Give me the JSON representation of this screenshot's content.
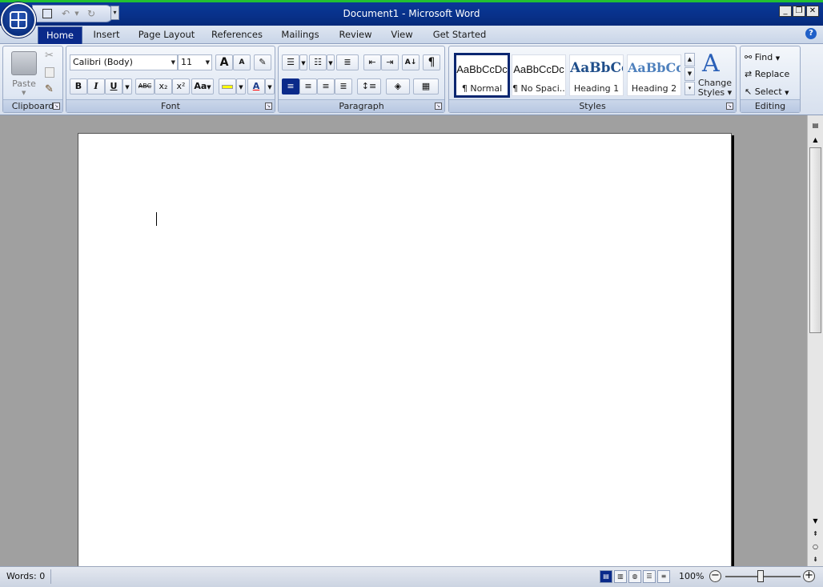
{
  "window": {
    "title": "Document1 - Microsoft Word",
    "controls": {
      "minimize": "_",
      "restore": "❐",
      "close": "✕"
    }
  },
  "quick_access": {
    "icons": [
      "save-icon",
      "undo-icon",
      "redo-icon",
      "customize-arrow-icon"
    ]
  },
  "tabs": [
    {
      "label": "Home",
      "active": true
    },
    {
      "label": "Insert"
    },
    {
      "label": "Page Layout"
    },
    {
      "label": "References"
    },
    {
      "label": "Mailings"
    },
    {
      "label": "Review"
    },
    {
      "label": "View"
    },
    {
      "label": "Get Started"
    }
  ],
  "ribbon": {
    "clipboard": {
      "label": "Clipboard",
      "paste_label": "Paste"
    },
    "font": {
      "label": "Font",
      "font_name": "Calibri (Body)",
      "font_size": "11",
      "bold": "B",
      "italic": "I",
      "underline": "U",
      "strikethrough": "ABC",
      "subscript": "x₂",
      "superscript": "x²",
      "change_case": "Aa",
      "grow_font": "A",
      "shrink_font": "A",
      "font_color": "A"
    },
    "paragraph": {
      "label": "Paragraph",
      "show_marks": "¶"
    },
    "styles": {
      "label": "Styles",
      "items": [
        {
          "sample": "AaBbCcDc",
          "name": "¶ Normal",
          "selected": true
        },
        {
          "sample": "AaBbCcDc",
          "name": "¶ No Spaci..."
        },
        {
          "sample": "AaBbCc",
          "name": "Heading 1"
        },
        {
          "sample": "AaBbCc",
          "name": "Heading 2"
        }
      ],
      "change_styles_label": "Change Styles"
    },
    "editing": {
      "label": "Editing",
      "find_label": "Find",
      "replace_label": "Replace",
      "select_label": "Select"
    }
  },
  "status": {
    "words": "Words: 0",
    "zoom": "100%"
  },
  "colors": {
    "title_bar": "#0a3a9a",
    "active_tab": "#0a2a8a",
    "highlight": "#ffff00",
    "font_color": "#ff0000"
  }
}
